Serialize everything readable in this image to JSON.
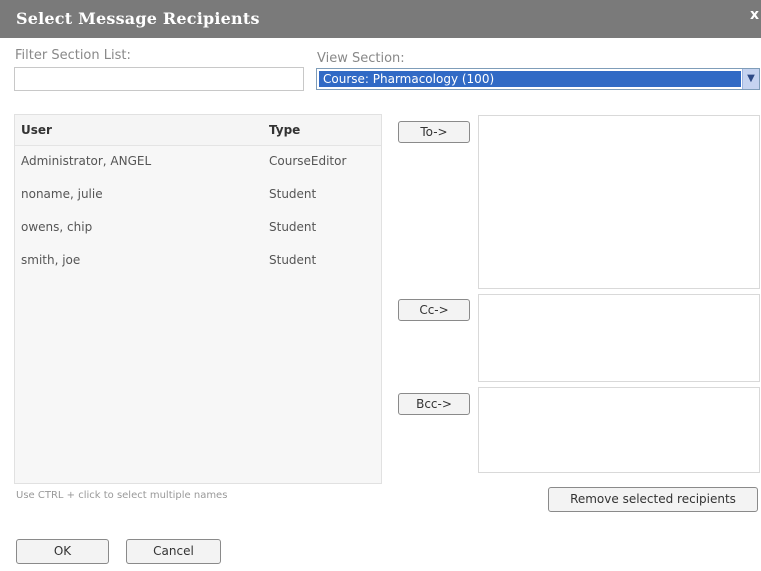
{
  "dialog": {
    "title": "Select Message Recipients",
    "close_label": "x"
  },
  "filter": {
    "label": "Filter Section List:",
    "value": ""
  },
  "view_section": {
    "label": "View Section:",
    "selected": "Course: Pharmacology (100)"
  },
  "user_list": {
    "headers": {
      "user": "User",
      "type": "Type"
    },
    "rows": [
      {
        "user": "Administrator, ANGEL",
        "type": "CourseEditor"
      },
      {
        "user": "noname, julie",
        "type": "Student"
      },
      {
        "user": "owens, chip",
        "type": "Student"
      },
      {
        "user": "smith, joe",
        "type": "Student"
      }
    ]
  },
  "recipients": {
    "to_label": "To->",
    "cc_label": "Cc->",
    "bcc_label": "Bcc->"
  },
  "hint": "Use CTRL + click to select multiple names",
  "buttons": {
    "remove": "Remove selected recipients",
    "ok": "OK",
    "cancel": "Cancel"
  }
}
